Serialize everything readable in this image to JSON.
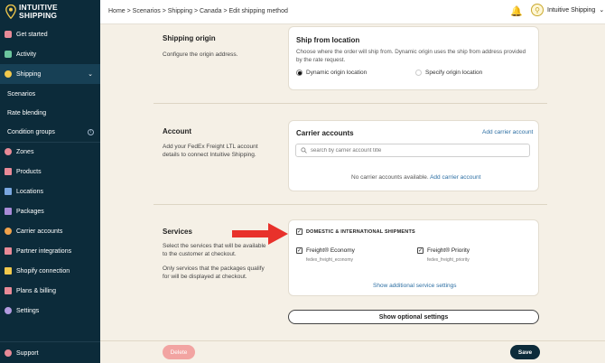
{
  "brand": {
    "line1": "INTUITIVE",
    "line2": "SHIPPING",
    "accent": "#f2c94c"
  },
  "sidebar": {
    "items": [
      {
        "label": "Get started",
        "icon": "rocket-icon"
      },
      {
        "label": "Activity",
        "icon": "activity-icon"
      },
      {
        "label": "Shipping",
        "icon": "bulb-icon"
      },
      {
        "label": "Scenarios"
      },
      {
        "label": "Rate blending"
      },
      {
        "label": "Condition groups"
      },
      {
        "label": "Zones",
        "icon": "zones-icon"
      },
      {
        "label": "Products",
        "icon": "products-icon"
      },
      {
        "label": "Locations",
        "icon": "locations-icon"
      },
      {
        "label": "Packages",
        "icon": "package-icon"
      },
      {
        "label": "Carrier accounts",
        "icon": "carrier-icon"
      },
      {
        "label": "Partner integrations",
        "icon": "partner-icon"
      },
      {
        "label": "Shopify connection",
        "icon": "shopify-icon"
      },
      {
        "label": "Plans & billing",
        "icon": "billing-icon"
      },
      {
        "label": "Settings",
        "icon": "gear-icon"
      }
    ],
    "support": "Support"
  },
  "header": {
    "breadcrumb": "Home > Scenarios > Shipping > Canada > Edit shipping method",
    "account": "Intuitive Shipping"
  },
  "origin": {
    "title": "Shipping origin",
    "desc": "Configure the origin address.",
    "card_title": "Ship from location",
    "card_text": "Choose where the order will ship from. Dynamic origin uses the ship from address provided by the rate request.",
    "opt_dynamic": "Dynamic origin location",
    "opt_specify": "Specify origin location"
  },
  "account": {
    "title": "Account",
    "desc": "Add your FedEx Freight LTL account details to connect Intuitive Shipping.",
    "card_title": "Carrier accounts",
    "add_link": "Add carrier account",
    "search_placeholder": "search by carrier account title",
    "empty": "No carrier accounts available.",
    "empty_link": "Add carrier account"
  },
  "services": {
    "title": "Services",
    "desc1": "Select the services that will be available to the customer at checkout.",
    "desc2": "Only services that the packages qualify for will be displayed at checkout.",
    "group": "DOMESTIC & INTERNATIONAL SHIPMENTS",
    "s1_name": "Freight® Economy",
    "s1_code": "fedex_freight_economy",
    "s2_name": "Freight® Priority",
    "s2_code": "fedex_freight_priority",
    "more": "Show additional service settings"
  },
  "buttons": {
    "optional": "Show optional settings",
    "delete": "Delete",
    "save": "Save"
  }
}
